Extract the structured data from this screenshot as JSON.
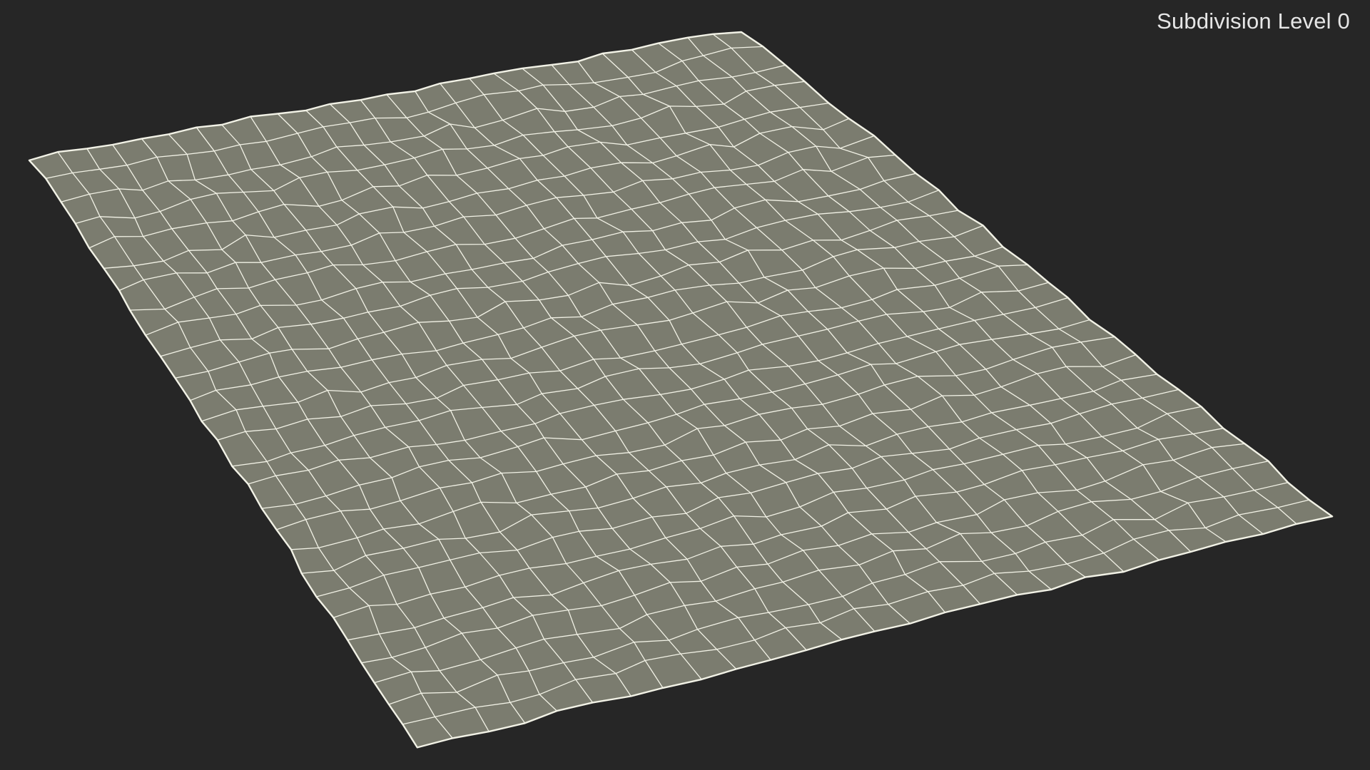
{
  "viewport": {
    "overlay_label": "Subdivision Level 0",
    "background_color": "#262626"
  },
  "mesh": {
    "object": "wireframe-plane",
    "surface_color": "#7b7c6f",
    "wire_color": "#f2f2e6",
    "columns": 26,
    "rows": 27
  }
}
